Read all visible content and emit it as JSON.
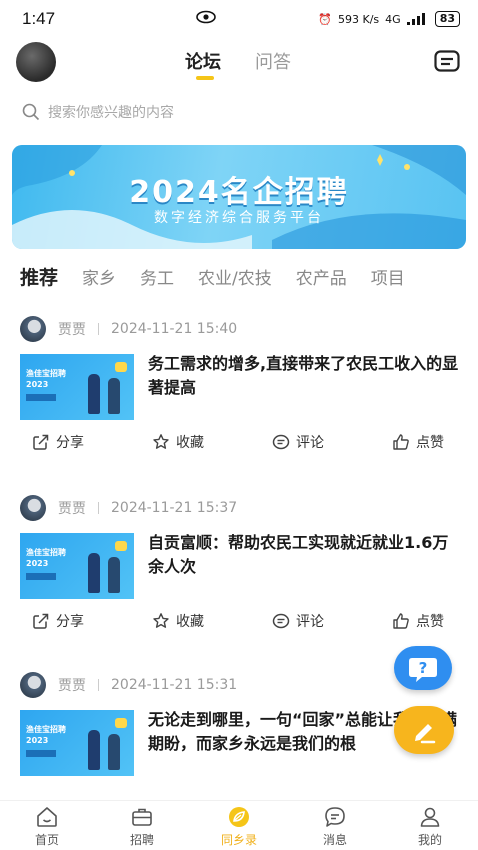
{
  "status_bar": {
    "time": "1:47",
    "speed": "593 K/s",
    "signal": "4G",
    "battery": "83"
  },
  "header": {
    "tabs": [
      "论坛",
      "问答"
    ],
    "active_tab": "论坛"
  },
  "search": {
    "placeholder": "搜索你感兴趣的内容"
  },
  "banner": {
    "title": "2024名企招聘",
    "subtitle": "数字经济综合服务平台"
  },
  "categories": [
    "推荐",
    "家乡",
    "务工",
    "农业/农技",
    "农产品",
    "项目"
  ],
  "thumbnail": {
    "line1": "渔佳宝招聘",
    "line2": "2023"
  },
  "posts": [
    {
      "author": "贾贾",
      "time": "2024-11-21 15:40",
      "title": "务工需求的增多,直接带来了农民工收入的显著提高"
    },
    {
      "author": "贾贾",
      "time": "2024-11-21 15:37",
      "title": "自贡富顺：帮助农民工实现就近就业1.6万余人次"
    },
    {
      "author": "贾贾",
      "time": "2024-11-21 15:31",
      "title": "无论走到哪里，一句“回家”总能让我们充满期盼，而家乡永远是我们的根"
    }
  ],
  "actions": {
    "share": "分享",
    "favorite": "收藏",
    "comment": "评论",
    "like": "点赞"
  },
  "bottom_nav": [
    "首页",
    "招聘",
    "同乡录",
    "消息",
    "我的"
  ],
  "active_nav": "同乡录",
  "colors": {
    "accent": "#f5c518",
    "nav_active": "#f0b01a",
    "fab_blue": "#2f8ef0",
    "fab_yellow": "#f7b51d"
  }
}
